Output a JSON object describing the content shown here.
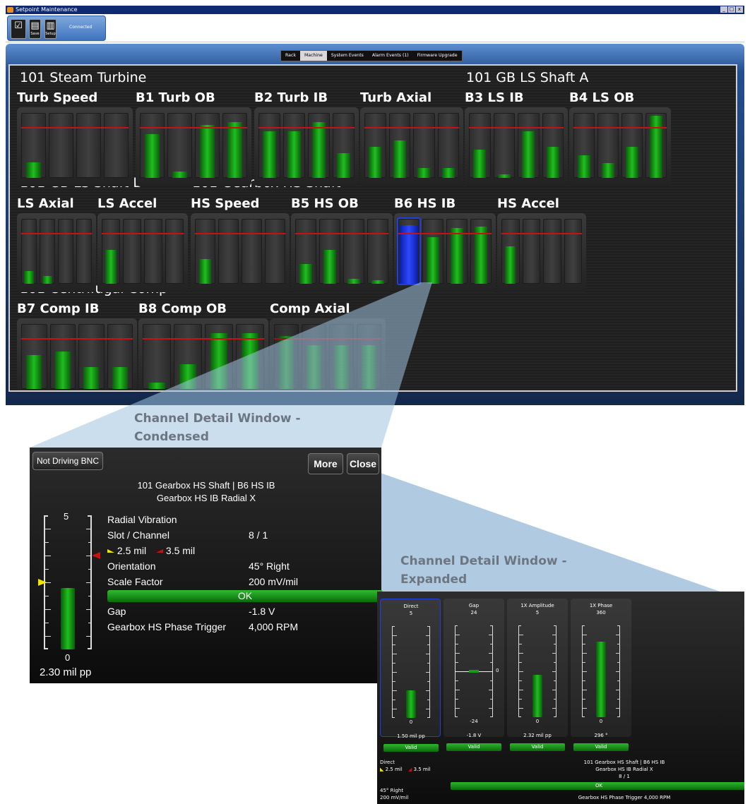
{
  "window": {
    "title": "Setpoint Maintenance",
    "controls": [
      "_",
      "□",
      "x"
    ]
  },
  "toolbar": {
    "save_label": "Save",
    "setup_label": "Setup",
    "status": "Connected"
  },
  "tabs": [
    "Rack",
    "Machine",
    "System Events",
    "Alarm Events (1)",
    "Firmware Upgrade"
  ],
  "active_tab": "Machine",
  "machine": {
    "trains": [
      {
        "name": "101 Steam Turbine"
      },
      {
        "name": "101 GB LS Shaft A"
      },
      {
        "name": "101 GB LS Shaft B"
      },
      {
        "name": "101 Gearbox HS Shaft"
      },
      {
        "name": "101 Centrifugal Comp"
      }
    ],
    "channels": [
      {
        "label": "Turb Speed",
        "levels": [
          0.25
        ]
      },
      {
        "label": "B1 Turb OB",
        "levels": [
          0.7,
          0.1,
          0.85,
          0.9
        ]
      },
      {
        "label": "B2 Turb IB",
        "levels": [
          0.75,
          0.75,
          0.9,
          0.4
        ]
      },
      {
        "label": "Turb Axial",
        "levels": [
          0.5,
          0.6,
          0.16,
          0.16
        ]
      },
      {
        "label": "B3 LS IB",
        "levels": [
          0.45,
          0.06,
          0.75,
          0.5
        ]
      },
      {
        "label": "B4 LS OB",
        "levels": [
          0.36,
          0.24,
          0.5,
          1.0
        ]
      },
      {
        "label": "LS Axial",
        "levels": [
          0.2,
          0.12
        ]
      },
      {
        "label": "LS Accel",
        "levels": [
          0.55
        ]
      },
      {
        "label": "HS Speed",
        "levels": [
          0.4
        ]
      },
      {
        "label": "B5 HS OB",
        "levels": [
          0.32,
          0.55,
          0.08,
          0.06
        ]
      },
      {
        "label": "B6 HS IB",
        "levels": [
          0.94,
          0.75,
          0.9,
          0.92
        ]
      },
      {
        "label": "HS Accel",
        "levels": [
          0.6
        ]
      },
      {
        "label": "B7 Comp IB",
        "levels": [
          0.55,
          0.6,
          0.35,
          0.35
        ]
      },
      {
        "label": "B8 Comp OB",
        "levels": [
          0.1,
          0.4,
          0.9,
          0.9
        ]
      },
      {
        "label": "Comp Axial",
        "levels": [
          0.85,
          0.7,
          0.7,
          0.7
        ]
      }
    ]
  },
  "annotations": {
    "condensed": "Channel Detail Window - Condensed",
    "expanded": "Channel Detail Window - Expanded"
  },
  "condensed": {
    "bnc_button": "Not Driving BNC",
    "more_button": "More",
    "close_button": "Close",
    "title_line1": "101 Gearbox HS Shaft | B6 HS IB",
    "title_line2": "Gearbox HS IB Radial X",
    "scale_top": "5",
    "scale_bottom": "0",
    "reading": "2.30 mil pp",
    "reading_level": 0.46,
    "measurement": "Radial Vibration",
    "slot_label": "Slot / Channel",
    "slot_value": "8 / 1",
    "alert_setpoint": "2.5 mil",
    "danger_setpoint": "3.5 mil",
    "orientation_label": "Orientation",
    "orientation_value": "45° Right",
    "scale_factor_label": "Scale Factor",
    "scale_factor_value": "200 mV/mil",
    "status": "OK",
    "gap_label": "Gap",
    "gap_value": "-1.8 V",
    "trigger_label": "Gearbox HS Phase Trigger",
    "trigger_value": "4,000 RPM"
  },
  "expanded": {
    "panels": [
      {
        "label": "Direct",
        "top": "5",
        "bottom": "0",
        "value": "1.50 mil pp",
        "status": "Valid",
        "level": 0.3
      },
      {
        "label": "Gap",
        "top": "24",
        "bottom": "-24",
        "mid": "0",
        "value": "-1.8 V",
        "status": "Valid",
        "level": 0.0
      },
      {
        "label": "1X Amplitude",
        "top": "5",
        "bottom": "0",
        "value": "2.32 mil pp",
        "status": "Valid",
        "level": 0.46
      },
      {
        "label": "1X Phase",
        "top": "360",
        "bottom": "0",
        "value": "296 °",
        "status": "Valid",
        "level": 0.82
      }
    ],
    "footer": {
      "measure": "Direct",
      "alert": "2.5 mil",
      "danger": "3.5 mil",
      "orientation": "45° Right",
      "scale": "200 mV/mil",
      "title_line1": "101 Gearbox HS Shaft | B6 HS IB",
      "title_line2": "Gearbox HS IB Radial X",
      "slot": "8 / 1",
      "status": "OK",
      "trigger": "Gearbox HS Phase Trigger   4,000 RPM"
    }
  },
  "colors": {
    "green": "#1fbf1f",
    "alarm_red": "#c41313",
    "alert_yellow": "#f2e600",
    "selection_blue": "#1f3fe0"
  }
}
